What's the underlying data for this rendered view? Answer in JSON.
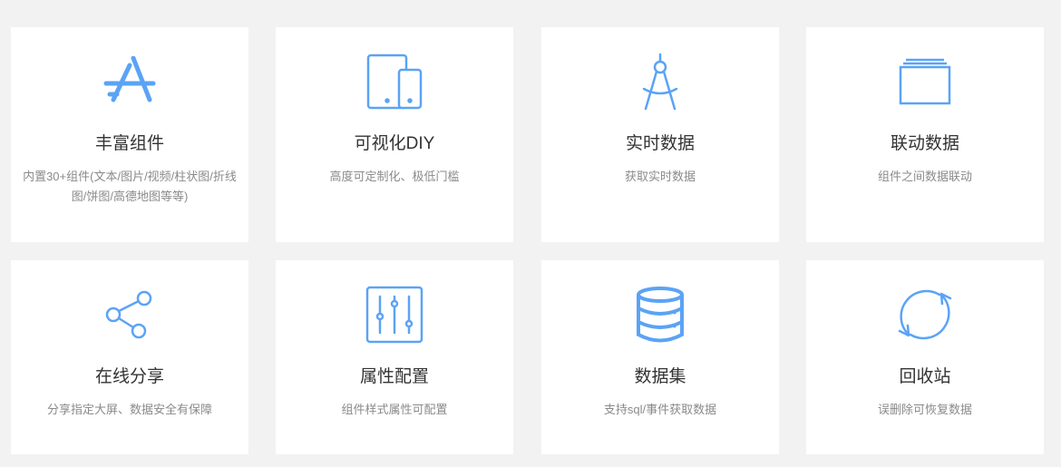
{
  "accent_color": "#5ba3f5",
  "features": [
    {
      "title": "丰富组件",
      "desc": "内置30+组件(文本/图片/视频/柱状图/折线图/饼图/高德地图等等)",
      "icon": "app-store-icon"
    },
    {
      "title": "可视化DIY",
      "desc": "高度可定制化、极低门槛",
      "icon": "devices-icon"
    },
    {
      "title": "实时数据",
      "desc": "获取实时数据",
      "icon": "compass-icon"
    },
    {
      "title": "联动数据",
      "desc": "组件之间数据联动",
      "icon": "window-stack-icon"
    },
    {
      "title": "在线分享",
      "desc": "分享指定大屏、数据安全有保障",
      "icon": "share-icon"
    },
    {
      "title": "属性配置",
      "desc": "组件样式属性可配置",
      "icon": "sliders-icon"
    },
    {
      "title": "数据集",
      "desc": "支持sql/事件获取数据",
      "icon": "database-icon"
    },
    {
      "title": "回收站",
      "desc": "误删除可恢复数据",
      "icon": "refresh-icon"
    }
  ]
}
